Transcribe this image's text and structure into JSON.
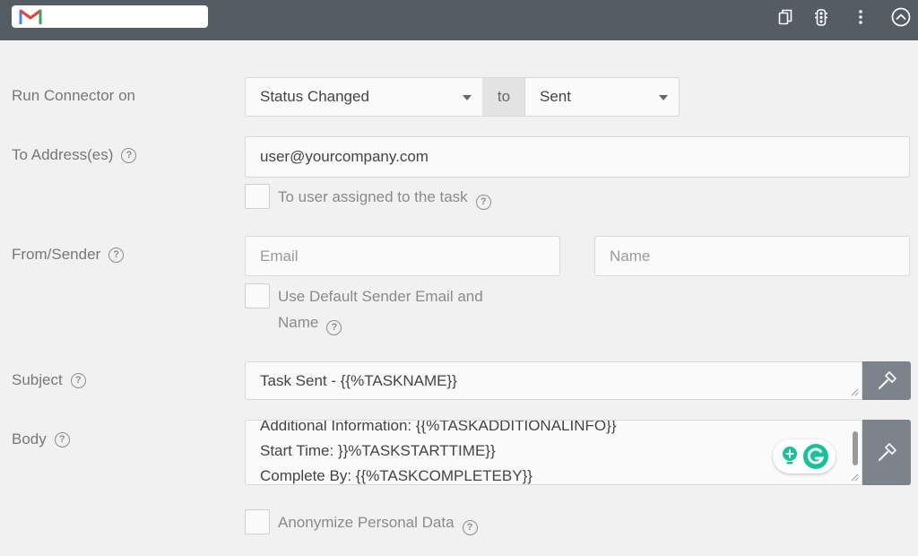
{
  "header": {
    "title_value": "",
    "icons": [
      "gmail-logo",
      "copy-icon",
      "traffic-light-icon",
      "more-vert-icon",
      "collapse-up-icon"
    ]
  },
  "run_connector": {
    "label": "Run Connector on",
    "trigger_value": "Status Changed",
    "to_label": "to",
    "status_value": "Sent"
  },
  "to_address": {
    "label": "To Address(es)",
    "value": "user@yourcompany.com",
    "assigned_checkbox_label": "To user assigned to the task"
  },
  "from_sender": {
    "label": "From/Sender",
    "email_placeholder": "Email",
    "name_placeholder": "Name",
    "default_checkbox_label_line1": "Use Default Sender Email and",
    "default_checkbox_label_line2": "Name"
  },
  "subject": {
    "label": "Subject",
    "value": "Task Sent - {{%TASKNAME}}"
  },
  "body": {
    "label": "Body",
    "lines": [
      "Additional Information: {{%TASKADDITIONALINFO}}",
      "Start Time: }}%TASKSTARTTIME}}",
      "Complete By: {{%TASKCOMPLETEBY}}"
    ]
  },
  "anonymize": {
    "label": "Anonymize Personal Data"
  },
  "colors": {
    "topbar": "#545c64",
    "tool_button": "#7c838b",
    "grammarly_green": "#15c39a",
    "gmail_blue": "#4285f4",
    "gmail_red": "#ea4335"
  }
}
